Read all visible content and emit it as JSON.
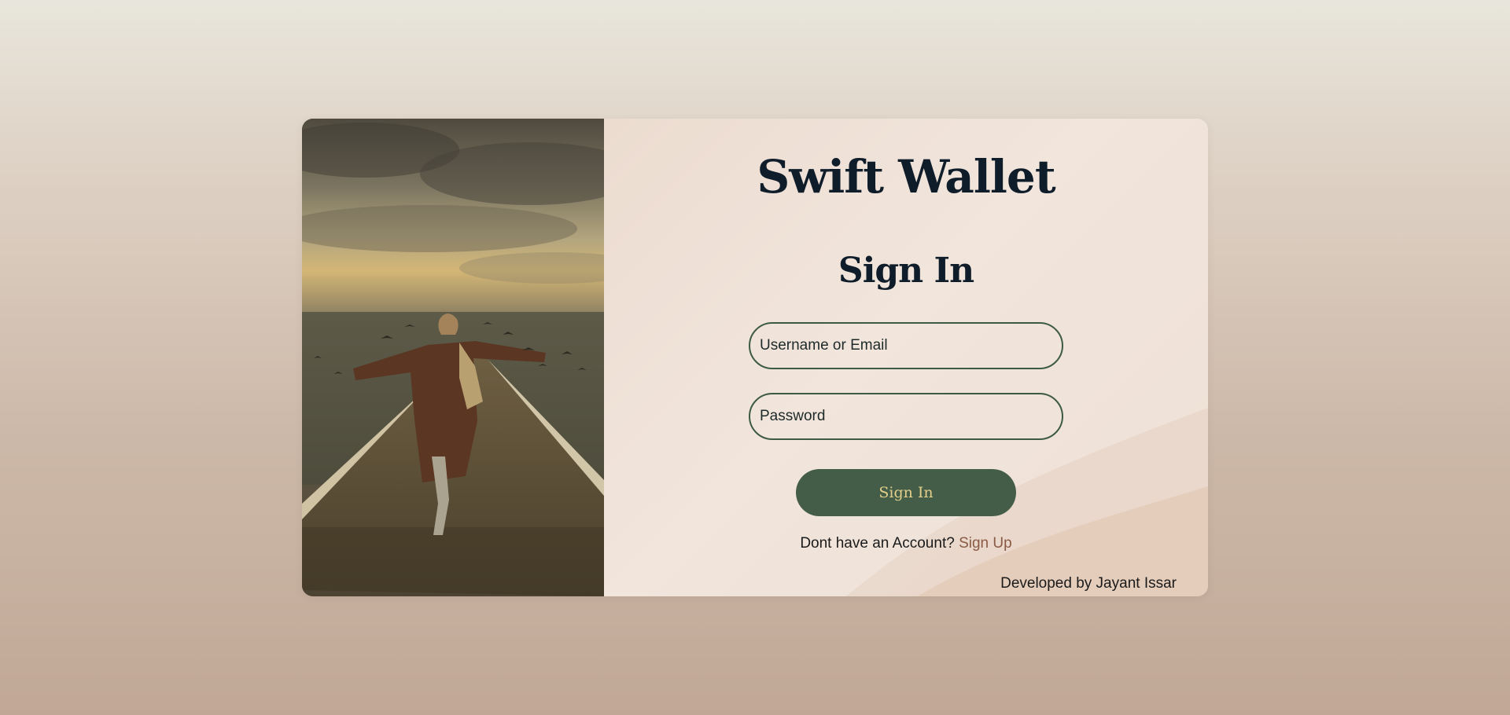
{
  "brand": {
    "title": "Swift Wallet"
  },
  "form": {
    "heading": "Sign In",
    "username_placeholder": "Username or Email",
    "password_placeholder": "Password",
    "submit_label": "Sign In"
  },
  "signup": {
    "prompt": "Dont have an Account?",
    "link_label": "Sign Up"
  },
  "footer": {
    "credit": "Developed by Jayant Issar"
  },
  "colors": {
    "button_bg": "#435d48",
    "button_text": "#e3cf8a",
    "field_border": "#3d5a45",
    "link": "#8a5a45",
    "title_text": "#0f1d2a"
  },
  "image": {
    "subject": "woman-running-on-pier-with-seagulls"
  }
}
